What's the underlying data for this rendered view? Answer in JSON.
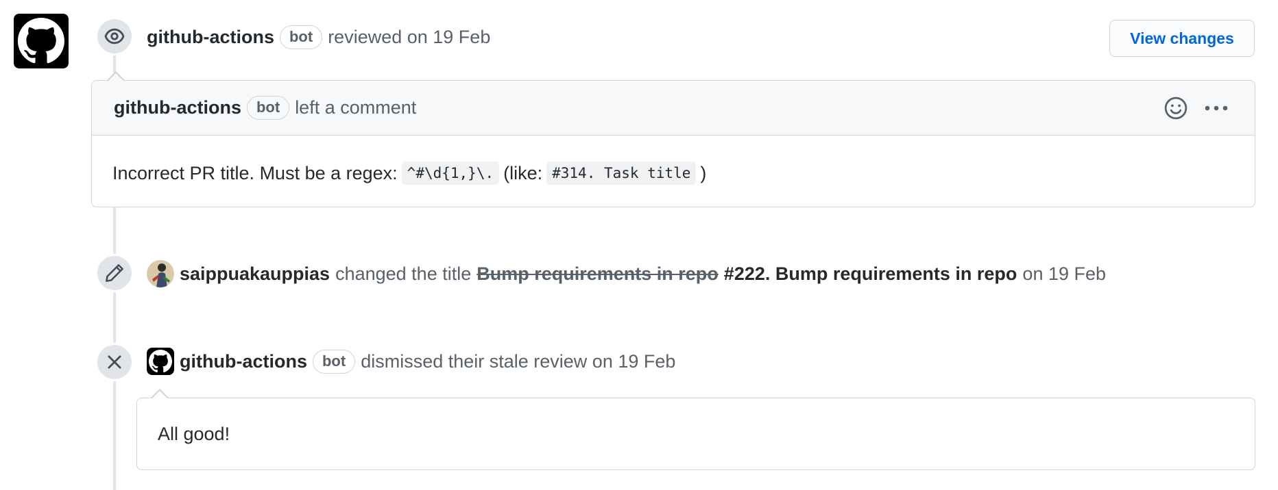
{
  "review_event": {
    "author": "github-actions",
    "bot_label": "bot",
    "action": "reviewed on 19 Feb",
    "view_changes_label": "View changes"
  },
  "comment": {
    "author": "github-actions",
    "bot_label": "bot",
    "action": "left a comment",
    "body_text": "Incorrect PR title. Must be a regex:",
    "regex_code": "^#\\d{1,}\\.",
    "like_open": "(like:",
    "example_code": "#314. Task title",
    "like_close": ")"
  },
  "title_change": {
    "author": "saippuakauppias",
    "action": "changed the title",
    "old_title": "Bump requirements in repo",
    "new_title": "#222. Bump requirements in repo",
    "date": "on 19 Feb"
  },
  "dismiss_event": {
    "author": "github-actions",
    "bot_label": "bot",
    "action": "dismissed their stale review on 19 Feb",
    "body": "All good!"
  },
  "icons": {
    "review": "eye-icon",
    "title_change": "pencil-icon",
    "dismiss": "x-icon",
    "reaction": "smiley-icon",
    "menu": "kebab-horizontal-icon"
  },
  "colors": {
    "link": "#0366d6",
    "badge_bg": "#e1e4e8",
    "border": "#d1d5da",
    "header_bg": "#f6f8fa"
  }
}
